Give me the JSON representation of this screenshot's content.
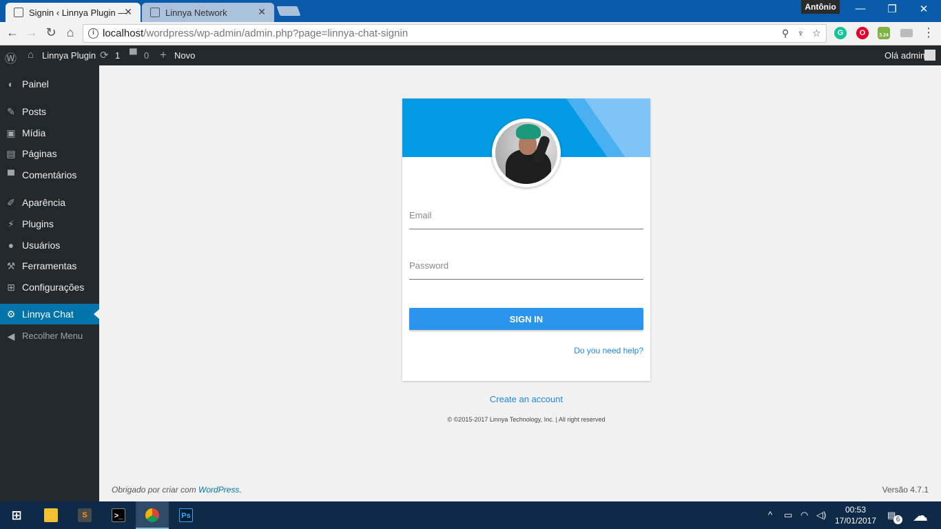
{
  "browser": {
    "tabs": [
      {
        "title": "Signin ‹ Linnya Plugin —",
        "active": true
      },
      {
        "title": "Linnya Network",
        "active": false
      }
    ],
    "user": "Antônio",
    "url_host": "localhost",
    "url_path": "/wordpress/wp-admin/admin.php?page=linnya-chat-signin",
    "extensions": [
      "grammarly-icon",
      "opera-icon",
      "android-badge-icon",
      "extension-icon"
    ],
    "extension_badge": "3.24"
  },
  "adminbar": {
    "site_name": "Linnya Plugin",
    "updates_count": "1",
    "comments_count": "0",
    "new_label": "Novo",
    "greeting": "Olá admin"
  },
  "sidebar": {
    "items": [
      {
        "label": "Painel",
        "icon": "dashboard-icon"
      },
      {
        "label": "Posts",
        "icon": "pin-icon"
      },
      {
        "label": "Mídia",
        "icon": "media-icon"
      },
      {
        "label": "Páginas",
        "icon": "pages-icon"
      },
      {
        "label": "Comentários",
        "icon": "comments-icon"
      },
      {
        "label": "Aparência",
        "icon": "brush-icon"
      },
      {
        "label": "Plugins",
        "icon": "plugin-icon"
      },
      {
        "label": "Usuários",
        "icon": "users-icon"
      },
      {
        "label": "Ferramentas",
        "icon": "wrench-icon"
      },
      {
        "label": "Configurações",
        "icon": "settings-icon"
      },
      {
        "label": "Linnya Chat",
        "icon": "gear-icon",
        "current": true
      },
      {
        "label": "Recolher Menu",
        "icon": "collapse-icon"
      }
    ]
  },
  "login": {
    "email_placeholder": "Email",
    "password_placeholder": "Password",
    "signin_label": "SIGN IN",
    "help_link": "Do you need help?",
    "create_account": "Create an account",
    "copyright": "© ©2015-2017 Linnya Technology, Inc. | All right reserved",
    "accent": "#2b95ed",
    "header_color": "#039be5"
  },
  "footer": {
    "thanks_prefix": "Obrigado por criar com ",
    "thanks_link": "WordPress",
    "thanks_suffix": ".",
    "version": "Versão 4.7.1"
  },
  "taskbar": {
    "apps": [
      "file-explorer-icon",
      "sublime-text-icon",
      "terminal-icon",
      "chrome-icon",
      "photoshop-icon"
    ],
    "time": "00:53",
    "date": "17/01/2017",
    "notifications": "6"
  }
}
